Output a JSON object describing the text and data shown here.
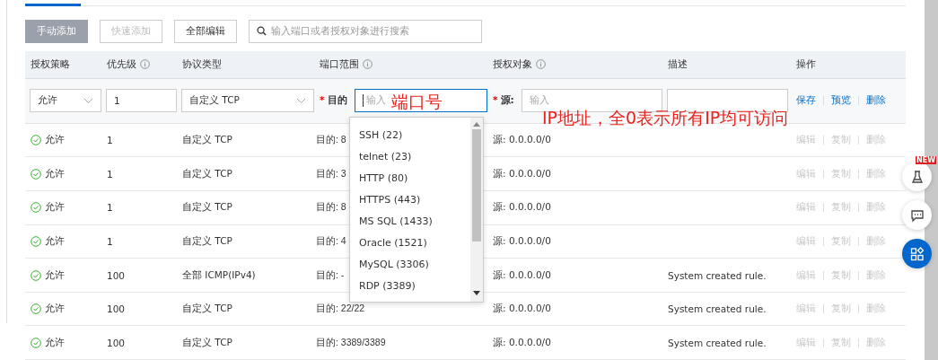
{
  "toolbar": {
    "buttons": [
      {
        "label": "手动添加",
        "kind": "primary",
        "disabled": true
      },
      {
        "label": "快速添加",
        "kind": "default",
        "disabled": true
      },
      {
        "label": "全部编辑",
        "kind": "default",
        "disabled": false
      }
    ],
    "search": {
      "placeholder": "输入端口或者授权对象进行搜索"
    }
  },
  "columns": [
    {
      "label": "授权策略",
      "info": false
    },
    {
      "label": "优先级",
      "info": true
    },
    {
      "label": "协议类型",
      "info": false
    },
    {
      "label": "端口范围",
      "info": true
    },
    {
      "label": "授权对象",
      "info": true
    },
    {
      "label": "描述",
      "info": false
    },
    {
      "label": "操作",
      "info": false
    }
  ],
  "edit_row": {
    "policy": "允许",
    "priority": "1",
    "protocol": "自定义 TCP",
    "required_mark": "*",
    "dest_label": "目的",
    "dest_placeholder": "输入",
    "source_label": "源:",
    "source_placeholder": "输入",
    "actions": [
      {
        "label": "保存",
        "disabled": false
      },
      {
        "label": "预览",
        "disabled": false
      },
      {
        "label": "删除",
        "disabled": false
      }
    ]
  },
  "port_dropdown": {
    "options": [
      "SSH (22)",
      "telnet (23)",
      "HTTP (80)",
      "HTTPS (443)",
      "MS SQL (1433)",
      "Oracle (1521)",
      "MySQL (3306)",
      "RDP (3389)"
    ]
  },
  "rows": [
    {
      "policy": "允许",
      "priority": "1",
      "protocol": "自定义 TCP",
      "port": "目的: 8",
      "source": "源: 0.0.0.0/0",
      "description": "",
      "actions": [
        {
          "label": "编辑",
          "disabled": true
        },
        {
          "label": "复制",
          "disabled": true
        },
        {
          "label": "删除",
          "disabled": true
        }
      ]
    },
    {
      "policy": "允许",
      "priority": "1",
      "protocol": "自定义 TCP",
      "port": "目的: 3",
      "source": "源: 0.0.0.0/0",
      "description": "",
      "actions": [
        {
          "label": "编辑",
          "disabled": true
        },
        {
          "label": "复制",
          "disabled": true
        },
        {
          "label": "删除",
          "disabled": true
        }
      ]
    },
    {
      "policy": "允许",
      "priority": "1",
      "protocol": "自定义 TCP",
      "port": "目的: 8",
      "source": "源: 0.0.0.0/0",
      "description": "",
      "actions": [
        {
          "label": "编辑",
          "disabled": true
        },
        {
          "label": "复制",
          "disabled": true
        },
        {
          "label": "删除",
          "disabled": true
        }
      ]
    },
    {
      "policy": "允许",
      "priority": "1",
      "protocol": "自定义 TCP",
      "port": "目的: 4",
      "source": "源: 0.0.0.0/0",
      "description": "",
      "actions": [
        {
          "label": "编辑",
          "disabled": true
        },
        {
          "label": "复制",
          "disabled": true
        },
        {
          "label": "删除",
          "disabled": true
        }
      ]
    },
    {
      "policy": "允许",
      "priority": "100",
      "protocol": "全部 ICMP(IPv4)",
      "port": "目的: -",
      "source": "源: 0.0.0.0/0",
      "description": "System created rule.",
      "actions": [
        {
          "label": "编辑",
          "disabled": true
        },
        {
          "label": "复制",
          "disabled": true
        },
        {
          "label": "删除",
          "disabled": true
        }
      ]
    },
    {
      "policy": "允许",
      "priority": "100",
      "protocol": "自定义 TCP",
      "port": "目的: 22/22",
      "source": "源: 0.0.0.0/0",
      "description": "System created rule.",
      "actions": [
        {
          "label": "编辑",
          "disabled": true
        },
        {
          "label": "复制",
          "disabled": true
        },
        {
          "label": "删除",
          "disabled": true
        }
      ]
    },
    {
      "policy": "允许",
      "priority": "100",
      "protocol": "自定义 TCP",
      "port": "目的: 3389/3389",
      "source": "源: 0.0.0.0/0",
      "description": "System created rule.",
      "actions": [
        {
          "label": "编辑",
          "disabled": true
        },
        {
          "label": "复制",
          "disabled": true
        },
        {
          "label": "删除",
          "disabled": true
        }
      ]
    }
  ],
  "annotations": [
    {
      "text": "端口号"
    },
    {
      "text": "IP地址，全0表示所有IP均可访问"
    }
  ],
  "side_buttons": [
    {
      "kind": "lab",
      "badge": "NEW",
      "active": false
    },
    {
      "kind": "chat",
      "active": false
    },
    {
      "kind": "apps",
      "active": true
    }
  ]
}
